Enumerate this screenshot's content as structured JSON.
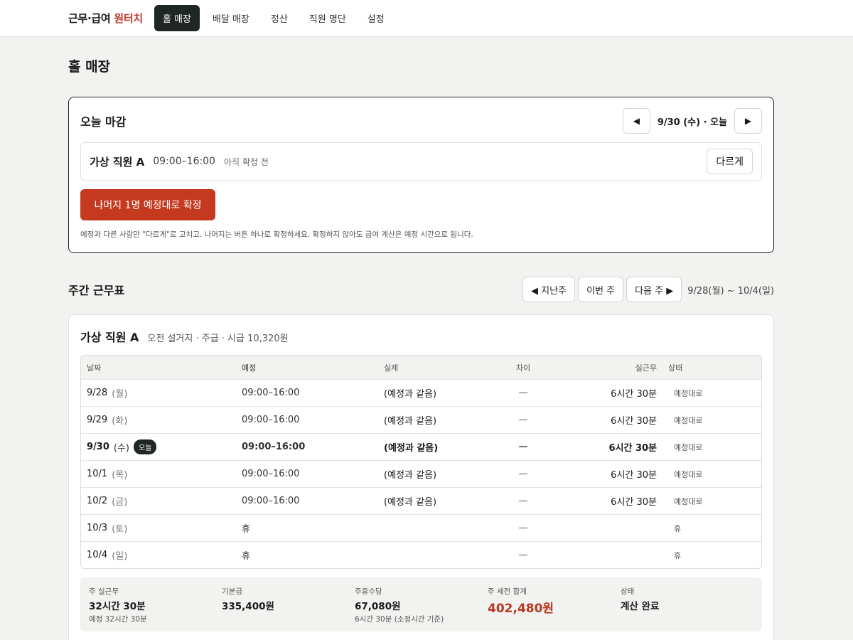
{
  "brand": {
    "prefix": "근무·급여",
    "accent": "원터치"
  },
  "nav": [
    {
      "label": "홀 매장",
      "active": true
    },
    {
      "label": "배달 매장"
    },
    {
      "label": "정산"
    },
    {
      "label": "직원 명단"
    },
    {
      "label": "설정"
    }
  ],
  "page_title": "홀 매장",
  "closing": {
    "title": "오늘 마감",
    "prev_icon": "◀",
    "next_icon": "▶",
    "date_label": "9/30 (수) · 오늘",
    "staff": {
      "name": "가상 직원 A",
      "time": "09:00–16:00",
      "status": "아직 확정 전",
      "diff_label": "다르게"
    },
    "confirm_label": "나머지 1명 예정대로 확정",
    "note": "예정과 다른 사람만 \"다르게\"로 고치고, 나머지는 버튼 하나로 확정하세요. 확정하지 않아도 급여 계산은 예정 시간으로 됩니다."
  },
  "week": {
    "title": "주간 근무표",
    "prev_label": "◀ 지난주",
    "this_label": "이번 주",
    "next_label": "다음 주 ▶",
    "range": "9/28(월) ~ 10/4(일)"
  },
  "employee": {
    "name": "가상 직원 A",
    "meta": "오전 설거지 · 주급 · 시급 10,320원",
    "columns": {
      "date": "날짜",
      "plan": "예정",
      "actual": "실제",
      "diff": "차이",
      "work": "실근무",
      "state": "상태"
    },
    "today_badge": "오늘",
    "rows": [
      {
        "date": "9/28",
        "dow": "(월)",
        "plan": "09:00–16:00",
        "actual": "(예정과 같음)",
        "diff": "—",
        "work": "6시간 30분",
        "state": "예정대로"
      },
      {
        "date": "9/29",
        "dow": "(화)",
        "plan": "09:00–16:00",
        "actual": "(예정과 같음)",
        "diff": "—",
        "work": "6시간 30분",
        "state": "예정대로"
      },
      {
        "date": "9/30",
        "dow": "(수)",
        "plan": "09:00–16:00",
        "actual": "(예정과 같음)",
        "diff": "—",
        "work": "6시간 30분",
        "state": "예정대로"
      },
      {
        "date": "10/1",
        "dow": "(목)",
        "plan": "09:00–16:00",
        "actual": "(예정과 같음)",
        "diff": "—",
        "work": "6시간 30분",
        "state": "예정대로"
      },
      {
        "date": "10/2",
        "dow": "(금)",
        "plan": "09:00–16:00",
        "actual": "(예정과 같음)",
        "diff": "—",
        "work": "6시간 30분",
        "state": "예정대로"
      },
      {
        "date": "10/3",
        "dow": "(토)",
        "plan": "휴",
        "actual": "",
        "diff": "—",
        "work": "",
        "state": "휴"
      },
      {
        "date": "10/4",
        "dow": "(일)",
        "plan": "휴",
        "actual": "",
        "diff": "—",
        "work": "",
        "state": "휴"
      }
    ],
    "summary": {
      "work": {
        "label": "주 실근무",
        "value": "32시간 30분",
        "sub": "예정 32시간 30분"
      },
      "base": {
        "label": "기본급",
        "value": "335,400원"
      },
      "holiday": {
        "label": "주휴수당",
        "value": "67,080원",
        "sub": "6시간 30분 (소정시간 기준)"
      },
      "total": {
        "label": "주 세전 합계",
        "value": "402,480원"
      },
      "state": {
        "label": "상태",
        "value": "계산 완료"
      }
    }
  },
  "colors": {
    "accent": "#c4391f",
    "dark": "#1f2623",
    "background": "#f2f2f0"
  }
}
